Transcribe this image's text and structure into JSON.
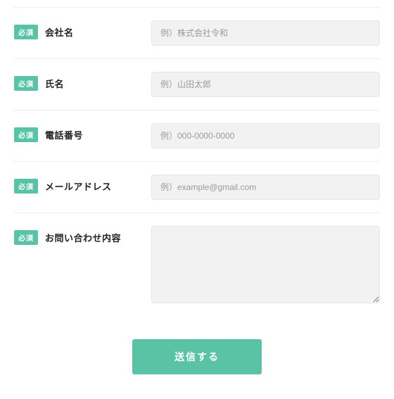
{
  "badge": "必須",
  "fields": {
    "company": {
      "label": "会社名",
      "placeholder": "例）株式会社令和"
    },
    "name": {
      "label": "氏名",
      "placeholder": "例）山田太郎"
    },
    "phone": {
      "label": "電話番号",
      "placeholder": "例）000-0000-0000"
    },
    "email": {
      "label": "メールアドレス",
      "placeholder": "例）example@gmail.com"
    },
    "message": {
      "label": "お問い合わせ内容",
      "placeholder": ""
    }
  },
  "submit": "送信する"
}
